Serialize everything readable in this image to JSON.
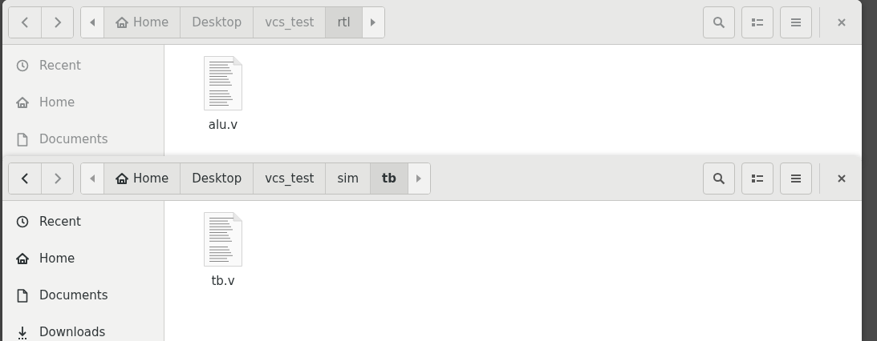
{
  "windows": [
    {
      "active": false,
      "path": [
        {
          "kind": "home",
          "label": "Home",
          "selected": false
        },
        {
          "kind": "folder",
          "label": "Desktop",
          "selected": false
        },
        {
          "kind": "folder",
          "label": "vcs_test",
          "selected": false
        },
        {
          "kind": "folder",
          "label": "rtl",
          "selected": true
        }
      ],
      "sidebar": {
        "items": [
          {
            "kind": "recent",
            "label": "Recent"
          },
          {
            "kind": "home",
            "label": "Home"
          },
          {
            "kind": "documents",
            "label": "Documents"
          }
        ]
      },
      "files": [
        {
          "name": "alu.v"
        }
      ]
    },
    {
      "active": true,
      "path": [
        {
          "kind": "home",
          "label": "Home",
          "selected": false
        },
        {
          "kind": "folder",
          "label": "Desktop",
          "selected": false
        },
        {
          "kind": "folder",
          "label": "vcs_test",
          "selected": false
        },
        {
          "kind": "folder",
          "label": "sim",
          "selected": false
        },
        {
          "kind": "folder",
          "label": "tb",
          "selected": true
        }
      ],
      "sidebar": {
        "items": [
          {
            "kind": "recent",
            "label": "Recent"
          },
          {
            "kind": "home",
            "label": "Home"
          },
          {
            "kind": "documents",
            "label": "Documents"
          },
          {
            "kind": "downloads",
            "label": "Downloads"
          }
        ]
      },
      "files": [
        {
          "name": "tb.v"
        }
      ]
    }
  ]
}
